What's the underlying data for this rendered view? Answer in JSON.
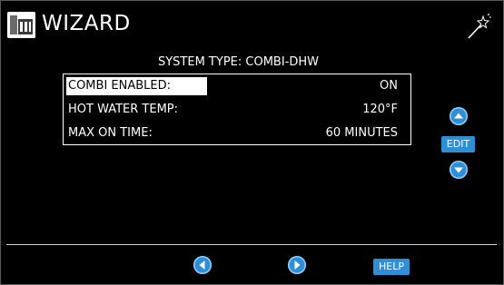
{
  "header": {
    "title": "WIZARD",
    "logo_icon": "app-logo-icon",
    "wizard_icon": "magic-wand-icon"
  },
  "main": {
    "system_type": "SYSTEM TYPE: COMBI-DHW",
    "rows": [
      {
        "label": "COMBI ENABLED:",
        "value": "ON",
        "selected": true
      },
      {
        "label": "HOT WATER TEMP:",
        "value": "120°F",
        "selected": false
      },
      {
        "label": "MAX ON TIME:",
        "value": "60 MINUTES",
        "selected": false
      }
    ]
  },
  "side_controls": {
    "up_icon": "chevron-up-icon",
    "edit_label": "EDIT",
    "down_icon": "chevron-down-icon"
  },
  "footer": {
    "prev_icon": "chevron-left-icon",
    "next_icon": "chevron-right-icon",
    "help_label": "HELP"
  },
  "colors": {
    "background": "#000000",
    "accent_button": "#2e8fd6",
    "button_ring": "#8fd0ff",
    "text": "#ffffff"
  }
}
